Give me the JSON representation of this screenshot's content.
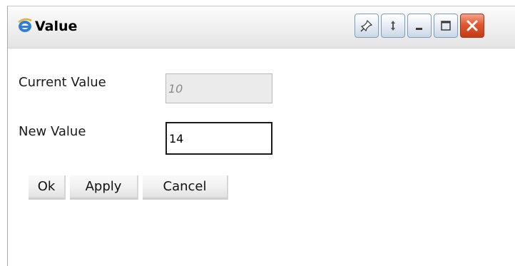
{
  "window": {
    "title": "Value"
  },
  "titlebar_buttons": [
    {
      "name": "pin",
      "icon": "pin-icon"
    },
    {
      "name": "refresh",
      "icon": "refresh-icon"
    },
    {
      "name": "minimize",
      "icon": "minimize-icon"
    },
    {
      "name": "maximize",
      "icon": "maximize-icon"
    },
    {
      "name": "close",
      "icon": "close-icon"
    }
  ],
  "form": {
    "current_value_label": "Current Value",
    "current_value": "10",
    "new_value_label": "New Value",
    "new_value": "14"
  },
  "buttons": {
    "ok": "Ok",
    "apply": "Apply",
    "cancel": "Cancel"
  },
  "colors": {
    "close_button": "#e1572f",
    "titlebar_button_border": "#7f9db9"
  }
}
